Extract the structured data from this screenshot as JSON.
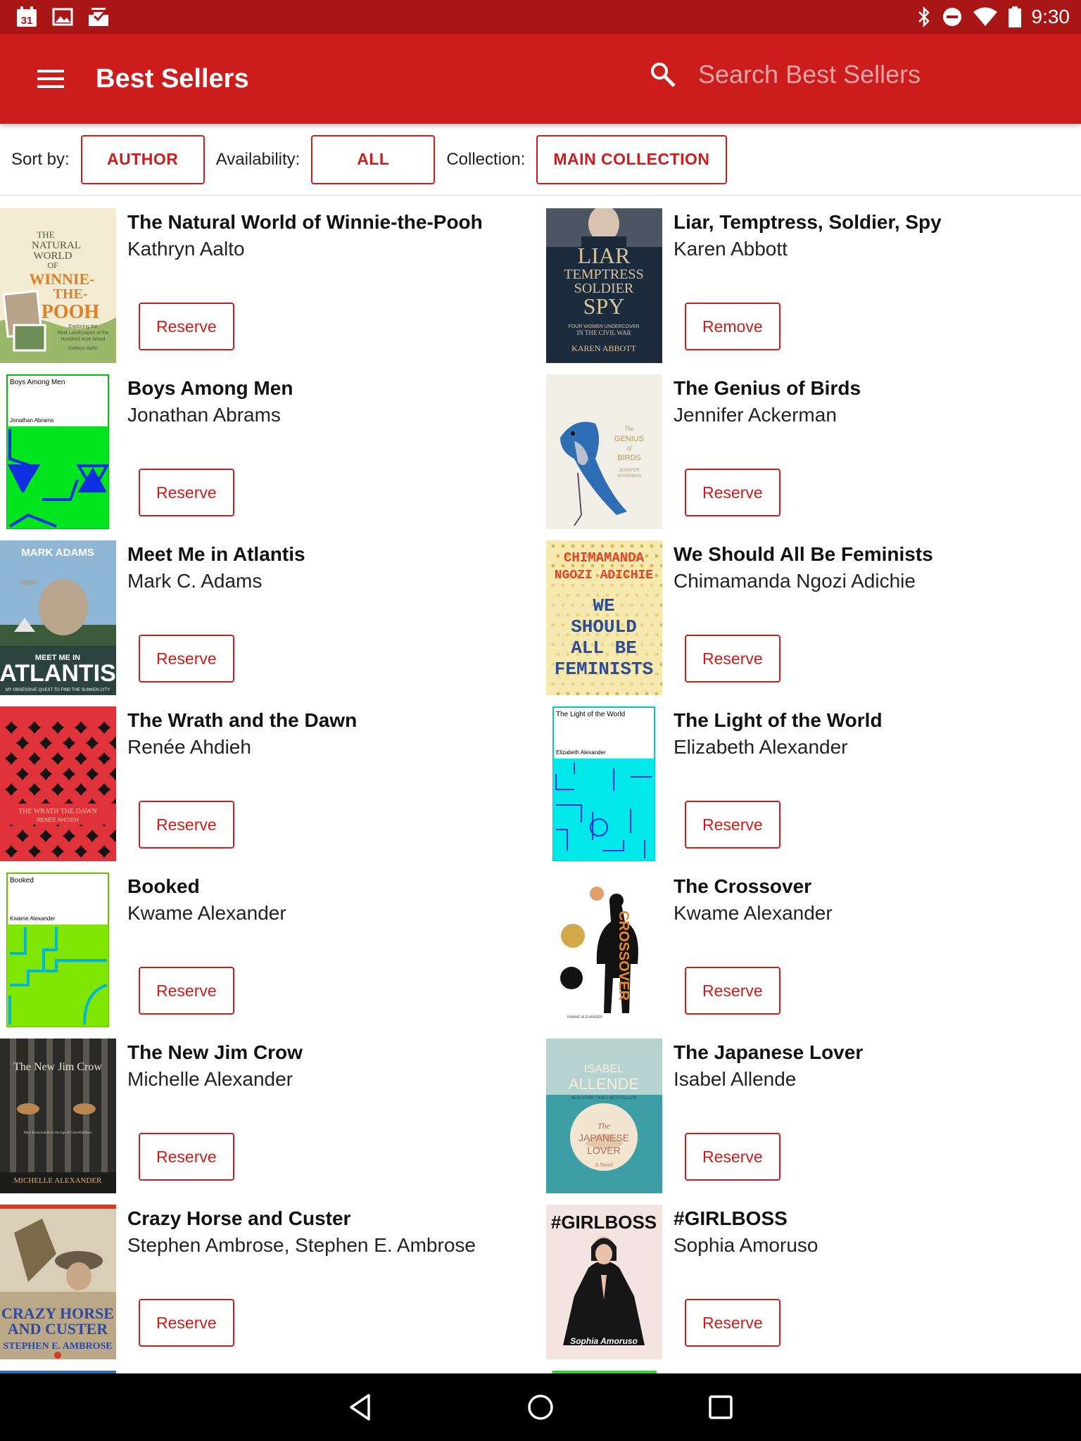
{
  "status_bar": {
    "time": "9:30",
    "left_icons": [
      "calendar-icon",
      "image-icon",
      "inbox-check-icon"
    ],
    "calendar_day": "31",
    "right_icons": [
      "bluetooth-icon",
      "do-not-disturb-icon",
      "wifi-icon",
      "battery-icon"
    ]
  },
  "app_bar": {
    "title": "Best Sellers",
    "search_placeholder": "Search Best Sellers",
    "background_color": "#cc1d1c"
  },
  "filters": {
    "sort_label": "Sort by:",
    "sort_value": "AUTHOR",
    "availability_label": "Availability:",
    "availability_value": "ALL",
    "collection_label": "Collection:",
    "collection_value": "MAIN COLLECTION"
  },
  "books": [
    {
      "title": "The Natural World of Winnie-the-Pooh",
      "author": "Kathryn Aalto",
      "action": "Reserve",
      "cover": {
        "style": "pooh",
        "lines": [
          "THE",
          "NATURAL",
          "WORLD",
          "OF",
          "WINNIE-",
          "THE-",
          "POOH",
          "Exploring the",
          "Real Landscapes of the",
          "Hundred Acre Wood",
          "Kathryn Aalto"
        ]
      }
    },
    {
      "title": "Liar, Temptress, Soldier, Spy",
      "author": "Karen Abbott",
      "action": "Remove",
      "cover": {
        "style": "liar",
        "lines": [
          "LIAR",
          "TEMPTRESS",
          "SOLDIER",
          "SPY",
          "FOUR WOMEN UNDERCOVER",
          "IN THE CIVIL WAR",
          "KAREN ABBOTT"
        ]
      }
    },
    {
      "title": "Boys Among Men",
      "author": "Jonathan Abrams",
      "action": "Reserve",
      "cover": {
        "style": "generated-green",
        "lines": [
          "Boys Among Men",
          "Jonathan Abrams"
        ]
      }
    },
    {
      "title": "The Genius of Birds",
      "author": "Jennifer Ackerman",
      "action": "Reserve",
      "cover": {
        "style": "birds",
        "lines": [
          "The",
          "GENIUS",
          "of",
          "BIRDS",
          "JENNIFER",
          "ACKERMAN"
        ]
      }
    },
    {
      "title": "Meet Me in Atlantis",
      "author": "Mark C. Adams",
      "action": "Reserve",
      "cover": {
        "style": "atlantis",
        "lines": [
          "MARK ADAMS",
          "MEET ME IN",
          "ATLANTIS",
          "MY OBSESSIVE QUEST TO FIND THE SUNKEN CITY"
        ]
      }
    },
    {
      "title": "We Should All Be Feminists",
      "author": "Chimamanda Ngozi Adichie",
      "action": "Reserve",
      "cover": {
        "style": "feminists",
        "lines": [
          "CHIMAMANDA",
          "NGOZI ADICHIE",
          "WE",
          "SHOULD",
          "ALL BE",
          "FEMINISTS"
        ]
      }
    },
    {
      "title": "The Wrath and the Dawn",
      "author": "Renée Ahdieh",
      "action": "Reserve",
      "cover": {
        "style": "wrath",
        "lines": [
          "THE WRATH THE DAWN",
          "RENÉE AHDIEH"
        ]
      }
    },
    {
      "title": "The Light of the World",
      "author": "Elizabeth Alexander",
      "action": "Reserve",
      "cover": {
        "style": "generated-cyan",
        "lines": [
          "The Light of the World",
          "Elizabeth Alexander"
        ]
      }
    },
    {
      "title": "Booked",
      "author": "Kwame Alexander",
      "action": "Reserve",
      "cover": {
        "style": "generated-lime",
        "lines": [
          "Booked",
          "Kwame Alexander"
        ]
      }
    },
    {
      "title": "The Crossover",
      "author": "Kwame Alexander",
      "action": "Reserve",
      "cover": {
        "style": "crossover",
        "lines": [
          "CROSSOVER",
          "KWAME ALEXANDER"
        ]
      }
    },
    {
      "title": "The New Jim Crow",
      "author": "Michelle Alexander",
      "action": "Reserve",
      "cover": {
        "style": "jimcrow",
        "lines": [
          "The New Jim Crow",
          "Mass Incarceration in the Age of Colorblindness",
          "MICHELLE ALEXANDER"
        ]
      }
    },
    {
      "title": "The Japanese Lover",
      "author": "Isabel Allende",
      "action": "Reserve",
      "cover": {
        "style": "japanese",
        "lines": [
          "ISABEL",
          "ALLENDE",
          "NEW YORK TIMES BESTSELLER",
          "The",
          "JAPANESE",
          "LOVER",
          "A Novel"
        ]
      }
    },
    {
      "title": "Crazy Horse and Custer",
      "author": "Stephen Ambrose, Stephen E. Ambrose",
      "action": "Reserve",
      "cover": {
        "style": "crazyhorse",
        "lines": [
          "CRAZY HORSE",
          "AND CUSTER",
          "STEPHEN E. AMBROSE"
        ]
      }
    },
    {
      "title": "#GIRLBOSS",
      "author": "Sophia Amoruso",
      "action": "Reserve",
      "cover": {
        "style": "girlboss",
        "lines": [
          "#GIRLBOSS",
          "Sophia Amoruso"
        ]
      }
    }
  ],
  "nav_bar": {
    "icons": [
      "back-icon",
      "home-icon",
      "recents-icon"
    ]
  }
}
